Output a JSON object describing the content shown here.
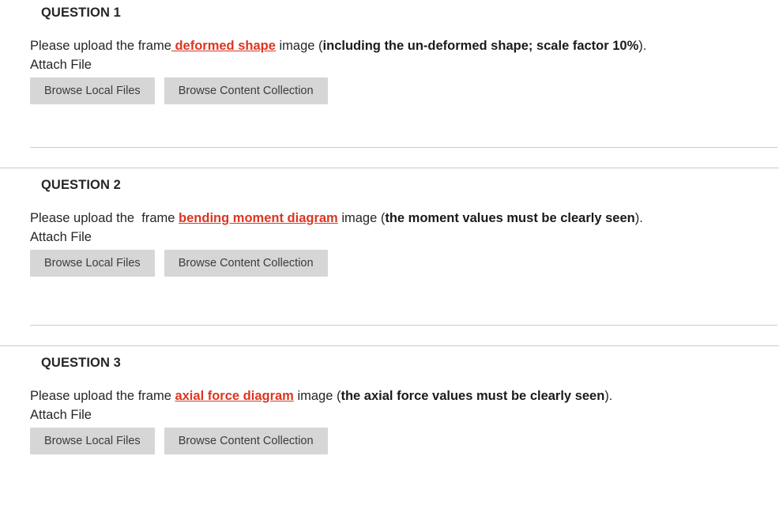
{
  "colors": {
    "link_red": "#dc3522",
    "text": "#262626",
    "button_bg": "#d6d6d6",
    "button_text": "#3c3c3c",
    "separator": "#cccccc",
    "page_bg": "#ffffff"
  },
  "attach_label": "Attach File",
  "buttons": {
    "browse_local": "Browse Local Files",
    "browse_content_collection": "Browse Content Collection"
  },
  "questions": [
    {
      "heading": "QUESTION 1",
      "prompt": {
        "lead": "Please upload the frame",
        "link": " deformed shape",
        "mid": " image (",
        "strong": "including the un-deformed shape; scale factor 10%",
        "tail": ")."
      }
    },
    {
      "heading": "QUESTION 2",
      "prompt": {
        "lead": "Please upload the  frame ",
        "link": "bending moment diagram",
        "mid": " image (",
        "strong": "the moment values must be clearly seen",
        "tail": ")."
      }
    },
    {
      "heading": "QUESTION 3",
      "prompt": {
        "lead": "Please upload the frame ",
        "link": "axial force diagram",
        "mid": " image (",
        "strong": "the axial force values must be clearly seen",
        "tail": ")."
      }
    }
  ]
}
